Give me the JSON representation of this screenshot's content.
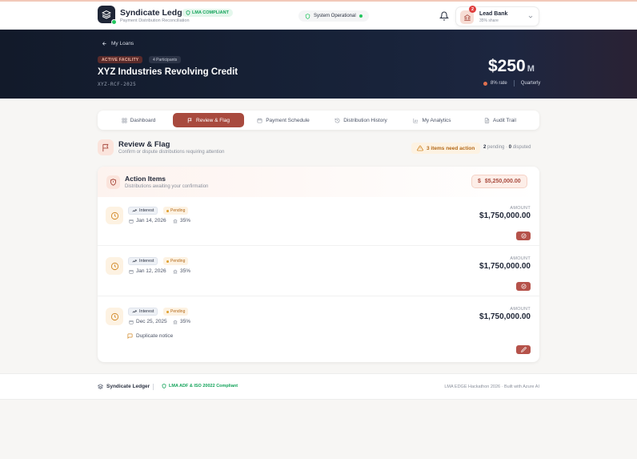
{
  "header": {
    "brand": "Syndicate Ledger",
    "brand_sub": "Payment Distribution Reconciliation",
    "lma_badge": "LMA COMPLIANT",
    "system_status": "System Operational",
    "notification_count": "2",
    "user_name": "Lead Bank",
    "user_share": "35% share"
  },
  "hero": {
    "back_label": "My Loans",
    "status_tag": "ACTIVE FACILITY",
    "participants_tag": "4 Participants",
    "title": "XYZ Industries Revolving Credit",
    "code": "XYZ-RCF-2025",
    "amount": "$250",
    "amount_unit": "M",
    "rate": "8% rate",
    "frequency": "Quarterly"
  },
  "tabs": [
    {
      "label": "Dashboard",
      "icon": "grid-icon"
    },
    {
      "label": "Review & Flag",
      "icon": "flag-icon",
      "active": true
    },
    {
      "label": "Payment Schedule",
      "icon": "calendar-icon"
    },
    {
      "label": "Distribution History",
      "icon": "history-icon"
    },
    {
      "label": "My Analytics",
      "icon": "bar-chart-icon"
    },
    {
      "label": "Audit Trail",
      "icon": "document-icon"
    }
  ],
  "section": {
    "title": "Review & Flag",
    "subtitle": "Confirm or dispute distributions requiring attention",
    "need_action": "3 items need action",
    "pending_count": "2",
    "pending_label": "pending",
    "disputed_count": "0",
    "disputed_label": "disputed"
  },
  "action_card": {
    "title": "Action Items",
    "subtitle": "Distributions awaiting your confirmation",
    "total": "$5,250,000.00",
    "total_currency_icon": "$",
    "items": [
      {
        "type": "Interest",
        "status": "Pending",
        "date": "Jan 14, 2026",
        "share": "35%",
        "amount_label": "AMOUNT",
        "amount": "$1,750,000.00",
        "note": "",
        "action_icon": "check-circle-icon"
      },
      {
        "type": "Interest",
        "status": "Pending",
        "date": "Jan 12, 2026",
        "share": "35%",
        "amount_label": "AMOUNT",
        "amount": "$1,750,000.00",
        "note": "",
        "action_icon": "check-circle-icon"
      },
      {
        "type": "Interest",
        "status": "Pending",
        "date": "Dec 25, 2025",
        "share": "35%",
        "amount_label": "AMOUNT",
        "amount": "$1,750,000.00",
        "note": "Duplicate notice",
        "action_icon": "edit-icon"
      }
    ]
  },
  "footer": {
    "brand": "Syndicate Ledger",
    "compliance": "LMA ADF & ISO 20022 Compliant",
    "right_text": "LMA EDGE Hackathon 2026  ·  Built with Azure AI"
  },
  "colors": {
    "accent": "#a84a3e",
    "hero_bg": "#121a2a",
    "success": "#22c55e",
    "warning": "#e0a030"
  }
}
